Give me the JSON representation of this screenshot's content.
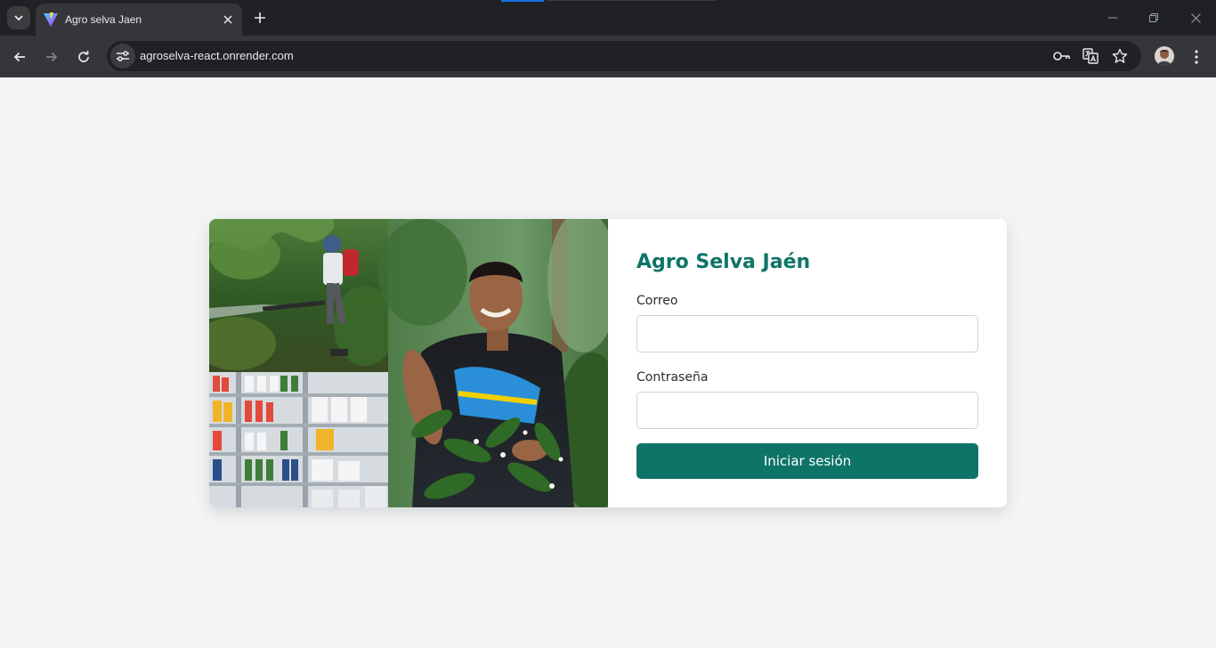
{
  "browser": {
    "tab_title": "Agro selva Jaen",
    "url": "agroselva-react.onrender.com",
    "icons": [
      "tab-search-icon",
      "favicon-icon",
      "close-icon",
      "plus-icon",
      "minimize-icon",
      "restore-icon",
      "close-window-icon",
      "back-arrow-icon",
      "forward-arrow-icon",
      "reload-icon",
      "site-settings-icon",
      "key-icon",
      "translate-icon",
      "star-icon",
      "more-vertical-icon"
    ]
  },
  "login": {
    "title": "Agro Selva Jaén",
    "email_label": "Correo",
    "email_value": "",
    "password_label": "Contraseña",
    "password_value": "",
    "submit_label": "Iniciar sesión"
  },
  "colors": {
    "brand": "#0f7468",
    "page_background": "#f3f4f6",
    "card_background": "#ffffff",
    "chrome_dark": "#202124",
    "chrome_toolbar": "#35363a"
  }
}
